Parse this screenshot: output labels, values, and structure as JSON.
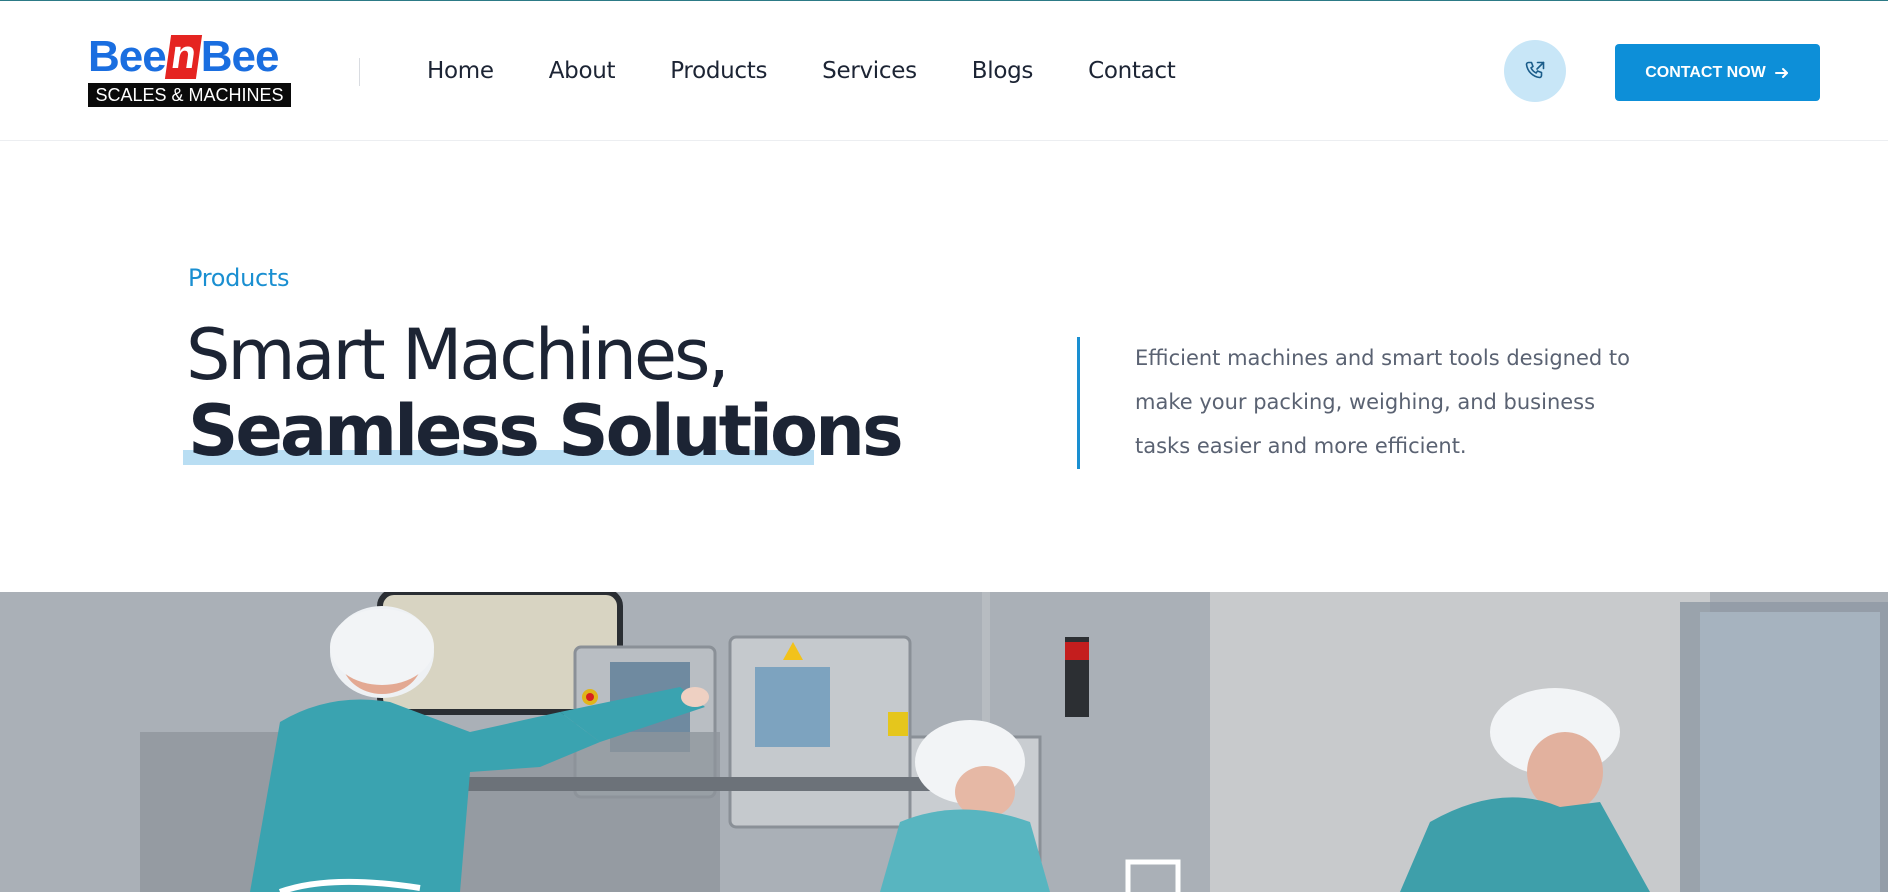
{
  "header": {
    "logo": {
      "word_left": "Bee",
      "word_mid": "n",
      "word_right": "Bee",
      "tagline": "SCALES & MACHINES"
    },
    "nav": [
      {
        "label": "Home"
      },
      {
        "label": "About"
      },
      {
        "label": "Products"
      },
      {
        "label": "Services"
      },
      {
        "label": "Blogs"
      },
      {
        "label": "Contact"
      }
    ],
    "phone_icon": "phone-outgoing-icon",
    "cta_label": "CONTACT NOW",
    "cta_icon": "arrow-right-icon"
  },
  "hero": {
    "eyebrow": "Products",
    "title_line1": "Smart Machines,",
    "title_line2": "Seamless Solutions",
    "description": "Efficient machines and smart tools designed to make your packing, weighing, and business tasks easier and more efficient."
  },
  "photo": {
    "subject": "workers in hairnets and teal lab coats operating packaging machines in a factory"
  },
  "colors": {
    "accent": "#0d8fd8",
    "eyebrow": "#1a8fd1",
    "highlight": "#b9def3",
    "phone_bg": "#c8e6f7",
    "logo_blue": "#1a6ee0",
    "logo_red": "#e52421",
    "heading": "#1c2434",
    "body_text": "#5a6272"
  }
}
